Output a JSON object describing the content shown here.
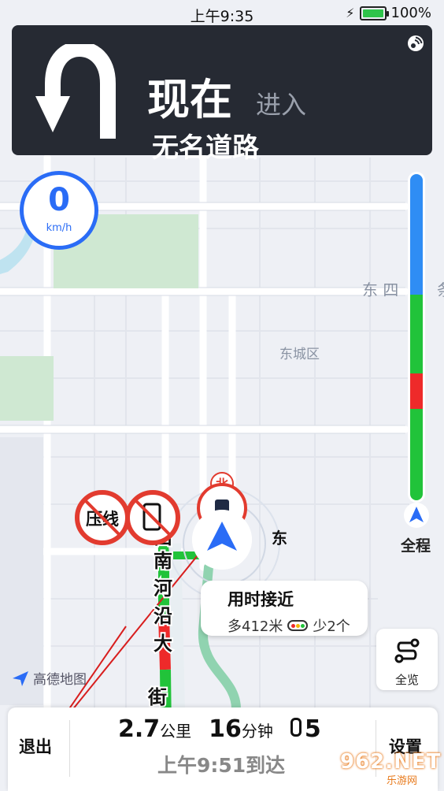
{
  "status_bar": {
    "time": "上午9:35",
    "battery_percent": "100%",
    "battery_level": 1.0,
    "charging_icon": "bolt-icon"
  },
  "guidance": {
    "when": "现在",
    "action": "进入",
    "road": "无名道路",
    "turn_icon": "u-turn-icon",
    "signal_icon": "gps-signal-icon"
  },
  "speed": {
    "value": "0",
    "unit": "km/h"
  },
  "map_labels": {
    "district": "东城区",
    "street_top_right": "东 四",
    "street_fragment": "条",
    "east_label": "东",
    "compass_north": "北",
    "road_vertical": [
      "西",
      "南",
      "河",
      "沿",
      "大",
      "街"
    ],
    "south_label": "南"
  },
  "restrictions": [
    {
      "label": "压线",
      "icon": "no-line-crossing-icon"
    },
    {
      "label": "",
      "icon": "no-phone-icon"
    }
  ],
  "progress": {
    "colors": {
      "blue": "#2f8df4",
      "green": "#21c33a",
      "red": "#ee2a2a"
    },
    "segments": [
      {
        "color": "blue",
        "fraction": 0.37
      },
      {
        "color": "green",
        "fraction": 0.24
      },
      {
        "color": "red",
        "fraction": 0.11
      },
      {
        "color": "green",
        "fraction": 0.28
      }
    ],
    "label": "全程"
  },
  "callout": {
    "title": "用时接近",
    "distance": "多412米",
    "lights": "少2个"
  },
  "fullview_button": {
    "label": "全览",
    "icon": "route-overview-icon"
  },
  "logo": {
    "text": "高德地图",
    "icon": "amap-logo-icon"
  },
  "bottom_panel": {
    "exit_label": "退出",
    "distance_value": "2.7",
    "distance_unit": "公里",
    "time_value": "16",
    "time_unit": "分钟",
    "lights_count": "5",
    "arrival": "上午9:51到达",
    "settings_label": "设置"
  },
  "watermark": {
    "text": "962.NET",
    "sub": "乐游网"
  },
  "accent_color": "#2a6cf6"
}
